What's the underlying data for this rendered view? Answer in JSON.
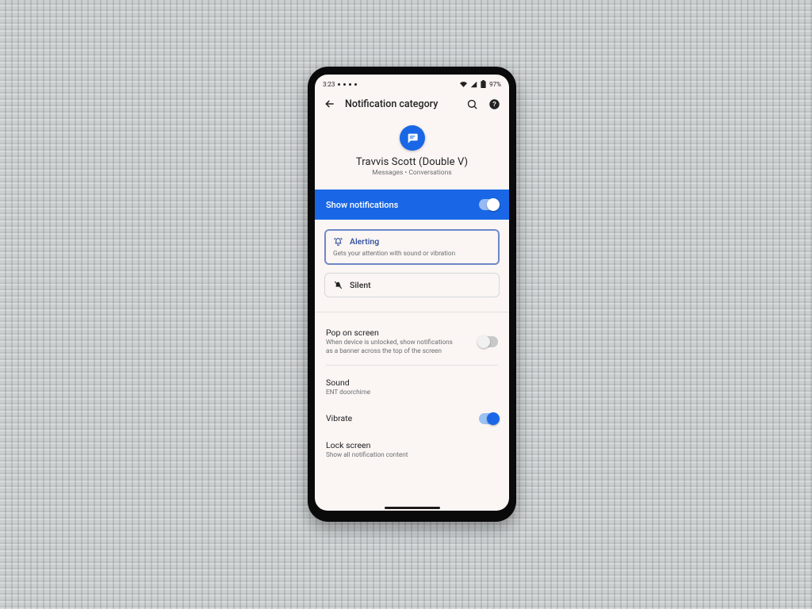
{
  "status": {
    "time": "3:23",
    "battery": "97%"
  },
  "appbar": {
    "title": "Notification category"
  },
  "hero": {
    "name": "Travvis Scott (Double V)",
    "subtitle": "Messages • Conversations"
  },
  "banner": {
    "label": "Show notifications",
    "enabled": true
  },
  "modes": {
    "alerting": {
      "label": "Alerting",
      "description": "Gets your attention with sound or vibration",
      "selected": true
    },
    "silent": {
      "label": "Silent",
      "selected": false
    }
  },
  "settings": {
    "pop": {
      "title": "Pop on screen",
      "subtitle": "When device is unlocked, show notifications as a banner across the top of the screen",
      "enabled": false
    },
    "sound": {
      "title": "Sound",
      "value": "ENT doorchime"
    },
    "vibrate": {
      "title": "Vibrate",
      "enabled": true
    },
    "lockscreen": {
      "title": "Lock screen",
      "value": "Show all notification content"
    }
  }
}
